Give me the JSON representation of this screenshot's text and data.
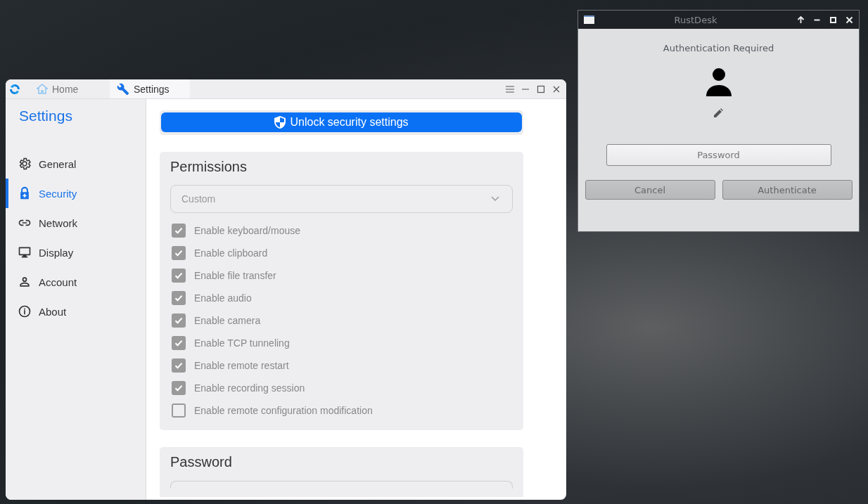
{
  "settings_window": {
    "tabs": [
      {
        "label": "Home",
        "kind": "home",
        "selected": false
      },
      {
        "label": "Settings",
        "kind": "settings",
        "selected": true
      }
    ],
    "sidebar": {
      "title": "Settings",
      "items": [
        {
          "label": "General",
          "kind": "gear",
          "selected": false
        },
        {
          "label": "Security",
          "kind": "lock",
          "selected": true
        },
        {
          "label": "Network",
          "kind": "link",
          "selected": false
        },
        {
          "label": "Display",
          "kind": "monitor",
          "selected": false
        },
        {
          "label": "Account",
          "kind": "person",
          "selected": false
        },
        {
          "label": "About",
          "kind": "info",
          "selected": false
        }
      ]
    },
    "unlock_button": "Unlock security settings",
    "permissions": {
      "title": "Permissions",
      "mode": "Custom",
      "options": [
        {
          "label": "Enable keyboard/mouse",
          "checked": true
        },
        {
          "label": "Enable clipboard",
          "checked": true
        },
        {
          "label": "Enable file transfer",
          "checked": true
        },
        {
          "label": "Enable audio",
          "checked": true
        },
        {
          "label": "Enable camera",
          "checked": true
        },
        {
          "label": "Enable TCP tunneling",
          "checked": true
        },
        {
          "label": "Enable remote restart",
          "checked": true
        },
        {
          "label": "Enable recording session",
          "checked": true
        },
        {
          "label": "Enable remote configuration modification",
          "checked": false
        }
      ]
    },
    "password": {
      "title": "Password"
    }
  },
  "auth_dialog": {
    "title": "RustDesk",
    "heading": "Authentication Required",
    "password": {
      "placeholder": "Password"
    },
    "buttons": [
      "Cancel",
      "Authenticate"
    ]
  }
}
